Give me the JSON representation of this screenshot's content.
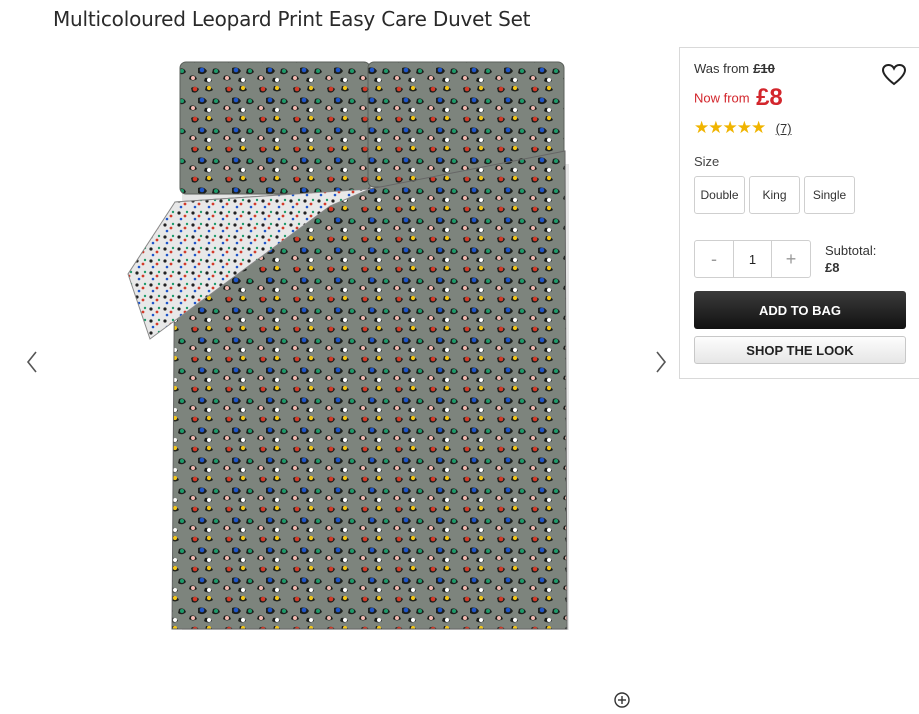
{
  "product": {
    "title": "Multicoloured Leopard Print Easy Care Duvet Set"
  },
  "pricing": {
    "was_label": "Was from",
    "was_price": "£10",
    "now_label": "Now from",
    "now_price": "£8"
  },
  "rating": {
    "stars": 5,
    "star_glyphs": "★★★★★",
    "count": "(7)"
  },
  "size": {
    "label": "Size",
    "options": [
      "Double",
      "King",
      "Single"
    ]
  },
  "quantity": {
    "minus": "-",
    "value": "1",
    "plus": "+"
  },
  "subtotal": {
    "label": "Subtotal:",
    "amount": "£8"
  },
  "actions": {
    "add_to_bag": "ADD TO BAG",
    "shop_the_look": "SHOP THE LOOK"
  },
  "icons": {
    "prev": "chevron-left-icon",
    "next": "chevron-right-icon",
    "wishlist": "heart-icon",
    "zoom": "zoom-icon"
  },
  "colors": {
    "sale_red": "#d3262c",
    "star_gold": "#f0b400",
    "primary_button": "#1e1e1e"
  }
}
